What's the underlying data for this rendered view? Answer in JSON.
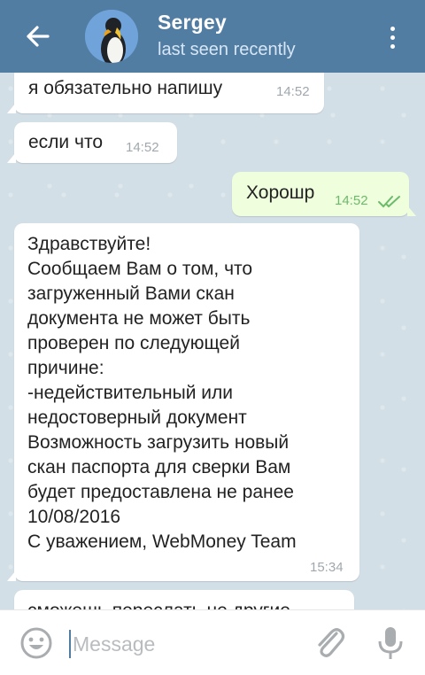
{
  "header": {
    "title": "Sergey",
    "status": "last seen recently"
  },
  "messages": [
    {
      "text": "я обязательно напишу",
      "time": "14:52",
      "dir": "in"
    },
    {
      "text": "если что",
      "time": "14:52",
      "dir": "in"
    },
    {
      "text": "Хорошр",
      "time": "14:52",
      "dir": "out",
      "read": true
    },
    {
      "text": "Здравствуйте!\nСообщаем Вам о том, что\nзагруженный Вами скан\nдокумента не может быть\nпроверен по следующей\nпричине:\n-недействительный или\nнедостоверный документ\nВозможность загрузить новый\nскан паспорта для сверки Вам\nбудет предоставлена не ранее\n10/08/2016\nС уважением, WebMoney Team",
      "time": "15:34",
      "dir": "in"
    },
    {
      "text": "сможешь переслать не другие",
      "dir": "in"
    }
  ],
  "composer": {
    "placeholder": "Message"
  },
  "colors": {
    "header": "#527da3",
    "outgoing_bubble": "#effedd",
    "read_check": "#6bbb6a"
  },
  "icons": [
    "back-arrow-icon",
    "avatar",
    "more-vertical-icon",
    "emoji-icon",
    "attach-icon",
    "mic-icon",
    "double-check-icon"
  ]
}
